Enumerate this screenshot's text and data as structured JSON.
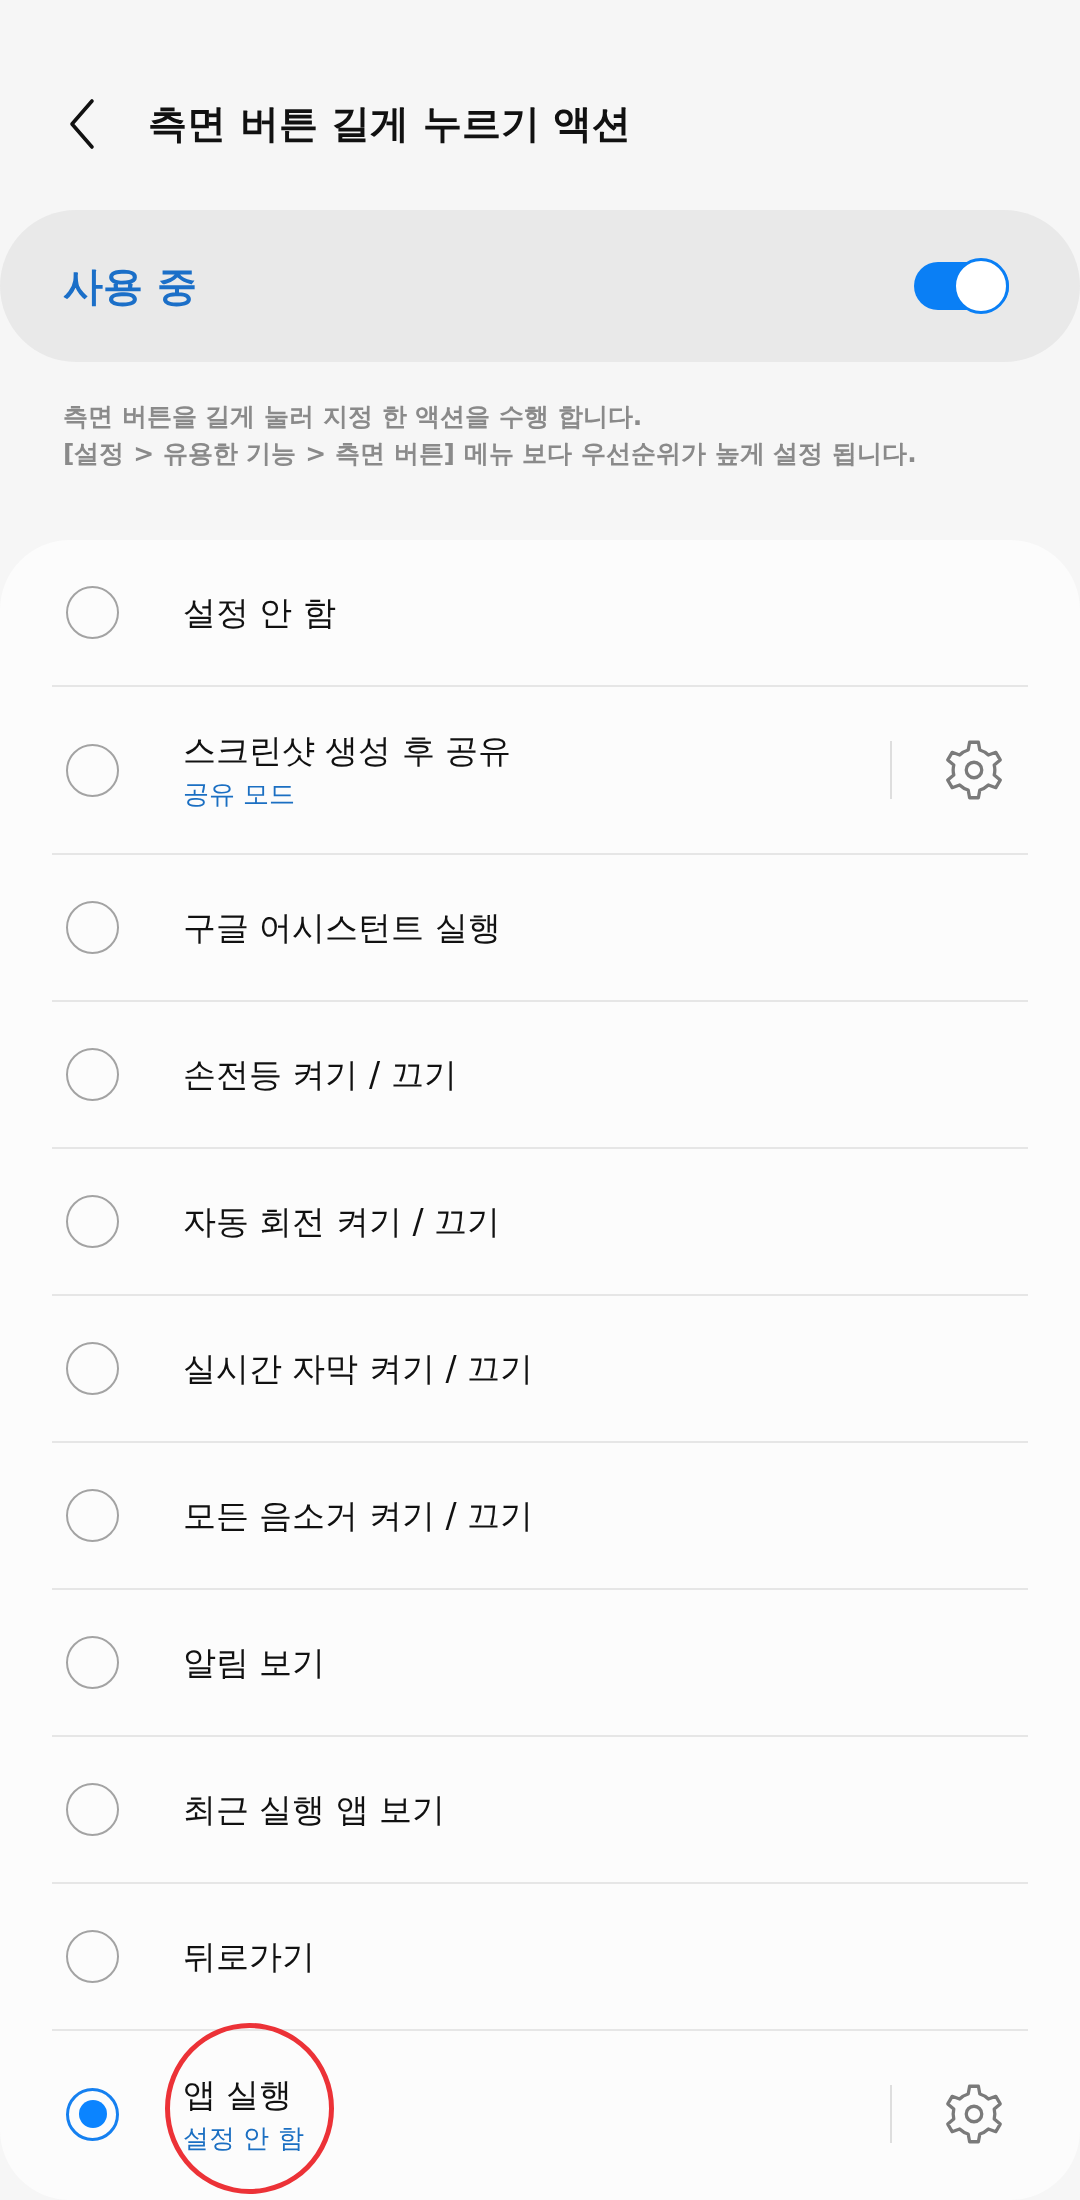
{
  "header": {
    "title": "측면 버튼 길게 누르기 액션"
  },
  "main_switch": {
    "label": "사용 중",
    "on": true
  },
  "description": [
    "측면 버튼을 길게 눌러 지정 한 액션을 수행 합니다.",
    "[설정 > 유용한 기능 > 측면 버튼] 메뉴 보다 우선순위가 높게 설정 됩니다."
  ],
  "options": [
    {
      "label": "설정 안 함",
      "selected": false,
      "settings": false,
      "highlighted": false
    },
    {
      "label": "스크린샷 생성 후 공유",
      "subtitle": "공유 모드",
      "selected": false,
      "settings": true,
      "highlighted": false
    },
    {
      "label": "구글 어시스턴트 실행",
      "selected": false,
      "settings": false,
      "highlighted": false
    },
    {
      "label": "손전등 켜기 / 끄기",
      "selected": false,
      "settings": false,
      "highlighted": false
    },
    {
      "label": "자동 회전 켜기 / 끄기",
      "selected": false,
      "settings": false,
      "highlighted": false
    },
    {
      "label": "실시간 자막 켜기 / 끄기",
      "selected": false,
      "settings": false,
      "highlighted": false
    },
    {
      "label": "모든 음소거 켜기 / 끄기",
      "selected": false,
      "settings": false,
      "highlighted": false
    },
    {
      "label": "알림 보기",
      "selected": false,
      "settings": false,
      "highlighted": false
    },
    {
      "label": "최근 실행 앱 보기",
      "selected": false,
      "settings": false,
      "highlighted": false
    },
    {
      "label": "뒤로가기",
      "selected": false,
      "settings": false,
      "highlighted": false
    },
    {
      "label": "앱 실행",
      "subtitle": "설정 안 함",
      "selected": true,
      "settings": true,
      "highlighted": true
    }
  ]
}
